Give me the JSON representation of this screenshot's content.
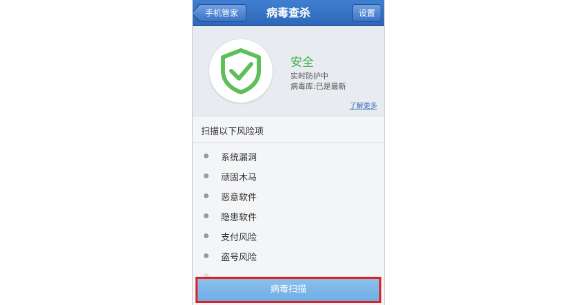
{
  "header": {
    "back_label": "手机管家",
    "title": "病毒查杀",
    "settings_label": "设置"
  },
  "status": {
    "title": "安全",
    "line1": "实时防护中",
    "line2": "病毒库:已是最新",
    "learn_more": "了解更多",
    "shield_color": "#5cbf58"
  },
  "section_title": "扫描以下风险项",
  "risk_items": [
    "系统漏洞",
    "顽固木马",
    "恶意软件",
    "隐患软件",
    "支付风险",
    "盗号风险"
  ],
  "scan_button_label": "病毒扫描",
  "colors": {
    "header_blue": "#2f67b8",
    "safe_green": "#3fb24b",
    "highlight_red": "#e02020",
    "button_blue": "#7cb6ea"
  }
}
